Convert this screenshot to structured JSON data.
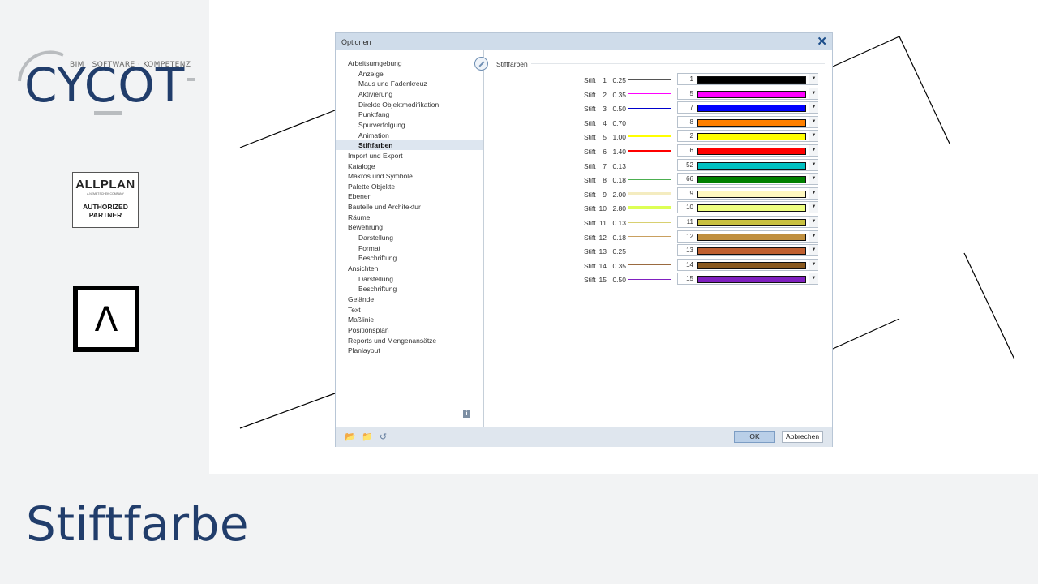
{
  "branding": {
    "cycot_tagline": "BIM · SOFTWARE · KOMPETENZ",
    "cycot_logo": "CYCOT",
    "allplan_brand": "ALLPLAN",
    "allplan_sub": "A NEMETSCHEK COMPANY",
    "allplan_badge": "AUTHORIZED PARTNER",
    "lambda_logo": "Λ"
  },
  "slide_title": "Stiftfarbe",
  "dialog": {
    "title": "Optionen",
    "close_icon": "close-icon",
    "tree": [
      {
        "label": "Arbeitsumgebung",
        "level": 0
      },
      {
        "label": "Anzeige",
        "level": 1
      },
      {
        "label": "Maus und Fadenkreuz",
        "level": 1
      },
      {
        "label": "Aktivierung",
        "level": 1
      },
      {
        "label": "Direkte Objektmodifikation",
        "level": 1
      },
      {
        "label": "Punktfang",
        "level": 1
      },
      {
        "label": "Spurverfolgung",
        "level": 1
      },
      {
        "label": "Animation",
        "level": 1
      },
      {
        "label": "Stiftfarben",
        "level": 1,
        "selected": true
      },
      {
        "label": "Import und Export",
        "level": 0
      },
      {
        "label": "Kataloge",
        "level": 0
      },
      {
        "label": "Makros und Symbole",
        "level": 0
      },
      {
        "label": "Palette Objekte",
        "level": 0
      },
      {
        "label": "Ebenen",
        "level": 0
      },
      {
        "label": "Bauteile und Architektur",
        "level": 0
      },
      {
        "label": "Räume",
        "level": 0
      },
      {
        "label": "Bewehrung",
        "level": 0
      },
      {
        "label": "Darstellung",
        "level": 1
      },
      {
        "label": "Format",
        "level": 1
      },
      {
        "label": "Beschriftung",
        "level": 1
      },
      {
        "label": "Ansichten",
        "level": 0
      },
      {
        "label": "Darstellung",
        "level": 1
      },
      {
        "label": "Beschriftung",
        "level": 1
      },
      {
        "label": "Gelände",
        "level": 0
      },
      {
        "label": "Text",
        "level": 0
      },
      {
        "label": "Maßlinie",
        "level": 0
      },
      {
        "label": "Positionsplan",
        "level": 0
      },
      {
        "label": "Reports und Mengenansätze",
        "level": 0
      },
      {
        "label": "Planlayout",
        "level": 0
      }
    ],
    "group_title": "Stiftfarben",
    "pen_label": "Stift",
    "pens": [
      {
        "num": "1",
        "width": "0.25",
        "color_num": "1",
        "color": "#000000",
        "line_color": "#555555"
      },
      {
        "num": "2",
        "width": "0.35",
        "color_num": "5",
        "color": "#ff00ff",
        "line_color": "#ff00ff"
      },
      {
        "num": "3",
        "width": "0.50",
        "color_num": "7",
        "color": "#0000ff",
        "line_color": "#0000cc"
      },
      {
        "num": "4",
        "width": "0.70",
        "color_num": "8",
        "color": "#ff8000",
        "line_color": "#ff8000"
      },
      {
        "num": "5",
        "width": "1.00",
        "color_num": "2",
        "color": "#ffff00",
        "line_color": "#ffff00"
      },
      {
        "num": "6",
        "width": "1.40",
        "color_num": "6",
        "color": "#ff0000",
        "line_color": "#ff0000"
      },
      {
        "num": "7",
        "width": "0.13",
        "color_num": "52",
        "color": "#00c0c0",
        "line_color": "#00c0c0"
      },
      {
        "num": "8",
        "width": "0.18",
        "color_num": "66",
        "color": "#008000",
        "line_color": "#4caf50"
      },
      {
        "num": "9",
        "width": "2.00",
        "color_num": "9",
        "color": "#fff8c0",
        "line_color": "#f4ecc0"
      },
      {
        "num": "10",
        "width": "2.80",
        "color_num": "10",
        "color": "#eeff80",
        "line_color": "#ddff55"
      },
      {
        "num": "11",
        "width": "0.13",
        "color_num": "11",
        "color": "#c8c040",
        "line_color": "#d8d070"
      },
      {
        "num": "12",
        "width": "0.18",
        "color_num": "12",
        "color": "#c09040",
        "line_color": "#c9a060"
      },
      {
        "num": "13",
        "width": "0.25",
        "color_num": "13",
        "color": "#c06030",
        "line_color": "#c07040"
      },
      {
        "num": "14",
        "width": "0.35",
        "color_num": "14",
        "color": "#8a5a20",
        "line_color": "#9a6a40"
      },
      {
        "num": "15",
        "width": "0.50",
        "color_num": "15",
        "color": "#8020c0",
        "line_color": "#8020c0"
      }
    ],
    "footer": {
      "icons": [
        "open-folder-icon",
        "save-folder-icon",
        "reset-icon"
      ],
      "ok_label": "OK",
      "cancel_label": "Abbrechen"
    },
    "info_icon": "info-icon"
  }
}
